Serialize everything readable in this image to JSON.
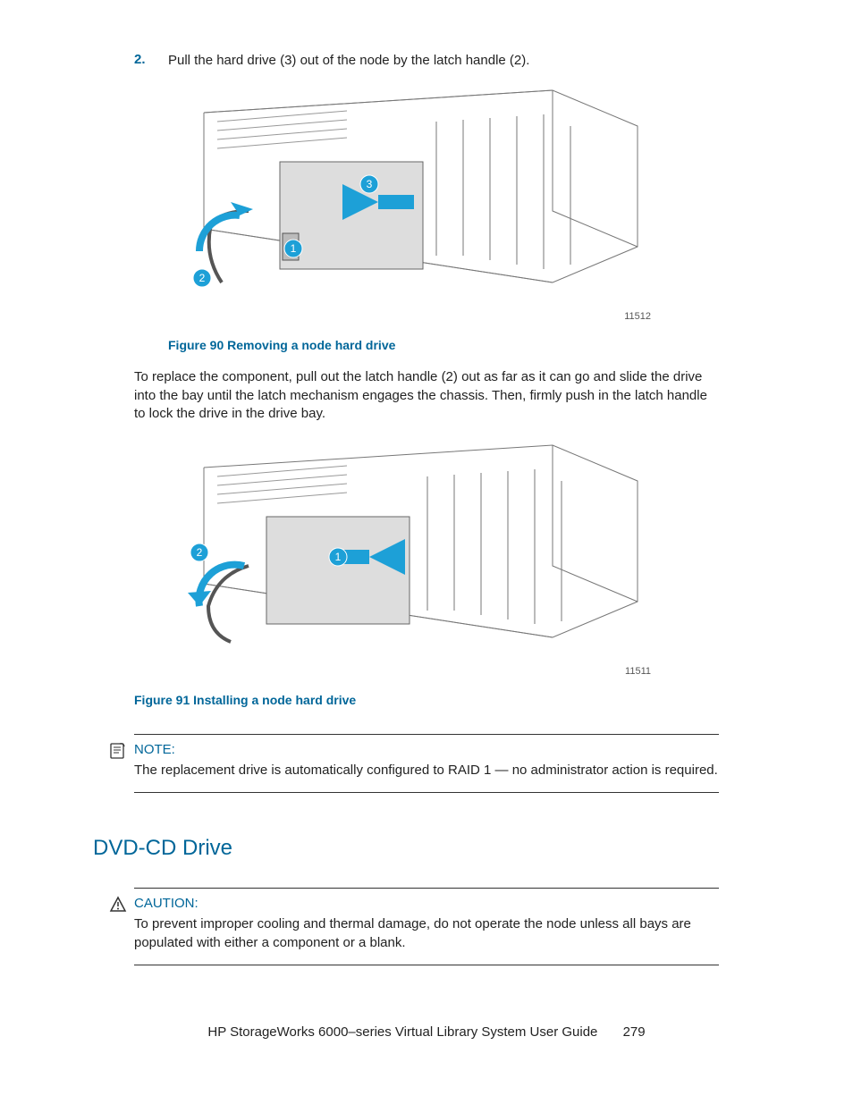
{
  "step": {
    "number": "2.",
    "text": "Pull the hard drive (3) out of the node by the latch handle (2)."
  },
  "figure90": {
    "caption": "Figure 90 Removing a node hard drive",
    "id": "11512",
    "callouts": [
      "1",
      "2",
      "3"
    ]
  },
  "replace_para": "To replace the component, pull out the latch handle (2) out as far as it can go and slide the drive into the bay until the latch mechanism engages the chassis. Then, firmly push in the latch handle to lock the drive in the drive bay.",
  "figure91": {
    "caption": "Figure 91 Installing a node hard drive",
    "id": "11511",
    "callouts": [
      "1",
      "2"
    ]
  },
  "note": {
    "title": "NOTE:",
    "body": "The replacement drive is automatically configured to RAID 1 — no administrator action is required."
  },
  "section_heading": "DVD-CD Drive",
  "caution": {
    "title": "CAUTION:",
    "body": "To prevent improper cooling and thermal damage, do not operate the node unless all bays are populated with either a component or a blank."
  },
  "footer": {
    "title": "HP StorageWorks 6000–series Virtual Library System User Guide",
    "page": "279"
  }
}
